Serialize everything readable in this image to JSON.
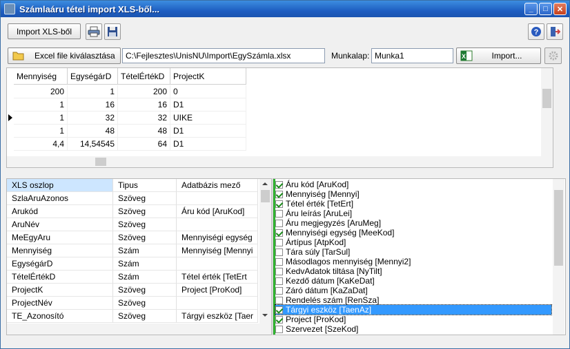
{
  "window": {
    "title": "Számlaáru tétel import XLS-ből..."
  },
  "toolbar": {
    "import_label": "Import XLS-ből"
  },
  "file": {
    "select_label": "Excel file kiválasztása",
    "path": "C:\\Fejlesztes\\UnisNU\\Import\\EgySzámla.xlsx",
    "sheet_label": "Munkalap:",
    "sheet": "Munka1",
    "import_label": "Import..."
  },
  "grid1": {
    "headers": [
      "Mennyiség",
      "EgységárD",
      "TételÉrtékD",
      "ProjectK"
    ],
    "rows": [
      [
        "200",
        "1",
        "200",
        "0"
      ],
      [
        "1",
        "16",
        "16",
        "D1"
      ],
      [
        "1",
        "32",
        "32",
        "UIKE"
      ],
      [
        "1",
        "48",
        "48",
        "D1"
      ],
      [
        "4,4",
        "14,54545",
        "64",
        "D1"
      ]
    ],
    "current_row": 2
  },
  "mapping": {
    "headers": [
      "XLS oszlop",
      "Tipus",
      "Adatbázis mező"
    ],
    "rows": [
      [
        "SzlaAruAzonos",
        "Szöveg",
        ""
      ],
      [
        "Arukód",
        "Szöveg",
        "Áru kód [AruKod]"
      ],
      [
        "AruNév",
        "Szöveg",
        ""
      ],
      [
        "MeEgyAru",
        "Szöveg",
        "Mennyiségi egység"
      ],
      [
        "Mennyiség",
        "Szám",
        "Mennyiség [Mennyi"
      ],
      [
        "EgységárD",
        "Szám",
        ""
      ],
      [
        "TételÉrtékD",
        "Szám",
        "Tétel érték [TetErt"
      ],
      [
        "ProjectK",
        "Szöveg",
        "Project [ProKod]"
      ],
      [
        "ProjectNév",
        "Szöveg",
        ""
      ],
      [
        "TE_Azonosító",
        "Szöveg",
        "Tárgyi eszköz [Taer"
      ]
    ]
  },
  "fields": [
    {
      "label": "Áru kód [AruKod]",
      "checked": true
    },
    {
      "label": "Mennyiség [Mennyi]",
      "checked": true
    },
    {
      "label": "Tétel érték [TetErt]",
      "checked": true
    },
    {
      "label": "Áru leírás [AruLei]",
      "checked": false
    },
    {
      "label": "Áru megjegyzés [AruMeg]",
      "checked": false
    },
    {
      "label": "Mennyiségi egység [MeeKod]",
      "checked": true
    },
    {
      "label": "Ártípus [AtpKod]",
      "checked": false
    },
    {
      "label": "Tára súly [TarSul]",
      "checked": false
    },
    {
      "label": "Másodlagos mennyiség [Mennyi2]",
      "checked": false
    },
    {
      "label": "KedvAdatok tiltása [NyTilt]",
      "checked": false
    },
    {
      "label": "Kezdő dátum [KaKeDat]",
      "checked": false
    },
    {
      "label": "Záró dátum [KaZaDat]",
      "checked": false
    },
    {
      "label": "Rendelés szám [RenSza]",
      "checked": false
    },
    {
      "label": "Tárgyi eszköz [TaenAz]",
      "checked": true,
      "selected": true
    },
    {
      "label": "Project [ProKod]",
      "checked": true
    },
    {
      "label": "Szervezet [SzeKod]",
      "checked": false
    }
  ],
  "icons": {
    "app": "app-icon",
    "print": "printer-icon",
    "save": "floppy-disk-icon",
    "help": "help-icon",
    "exit": "exit-icon",
    "folder": "open-folder-icon",
    "excel": "excel-icon",
    "settings": "gear-icon"
  },
  "colors": {
    "title_bar": "#2a6fd6",
    "selection": "#3399ff",
    "list_accent": "#2fb52f"
  }
}
